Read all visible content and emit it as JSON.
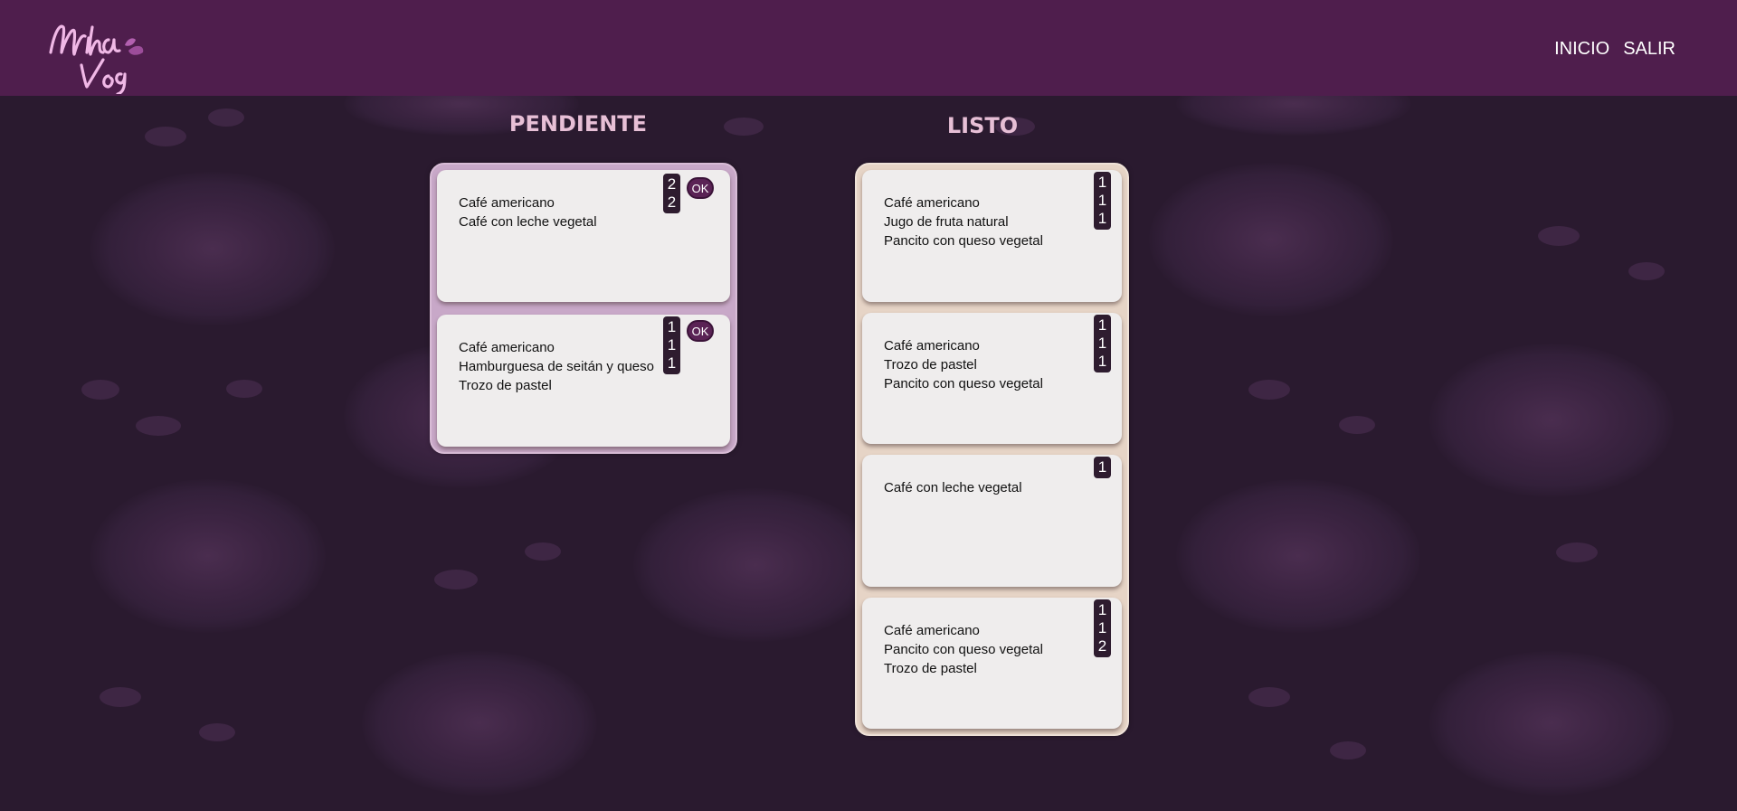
{
  "nav": {
    "home": "INICIO",
    "logout": "SALIR"
  },
  "logo_text": "Milha Veg",
  "columns": {
    "pending_title": "PENDIENTE",
    "done_title": "LISTO"
  },
  "pending": [
    {
      "items": [
        "Café americano",
        "Café con leche vegetal"
      ],
      "qty": [
        "2",
        "2"
      ],
      "button": "OK"
    },
    {
      "items": [
        "Café americano",
        "Hamburguesa de seitán y queso",
        "Trozo de pastel"
      ],
      "qty": [
        "1",
        "1",
        "1"
      ],
      "button": "OK"
    }
  ],
  "done": [
    {
      "items": [
        "Café americano",
        "Jugo de fruta natural",
        "Pancito con queso vegetal"
      ],
      "qty": [
        "1",
        "1",
        "1"
      ]
    },
    {
      "items": [
        "Café americano",
        "Trozo de pastel",
        "Pancito con queso vegetal"
      ],
      "qty": [
        "1",
        "1",
        "1"
      ]
    },
    {
      "items": [
        "Café con leche vegetal"
      ],
      "qty": [
        "1"
      ]
    },
    {
      "items": [
        "Café americano",
        "Pancito con queso vegetal",
        "Trozo de pastel"
      ],
      "qty": [
        "1",
        "1",
        "2"
      ]
    }
  ],
  "colors": {
    "header": "#4f1e4d",
    "background": "#2a1a2f",
    "title": "#e7bfd6",
    "pending_board": "#c8a8c8",
    "done_board": "#e6d4c6",
    "card": "#efeded",
    "qty_badge": "#2e1c2f"
  }
}
